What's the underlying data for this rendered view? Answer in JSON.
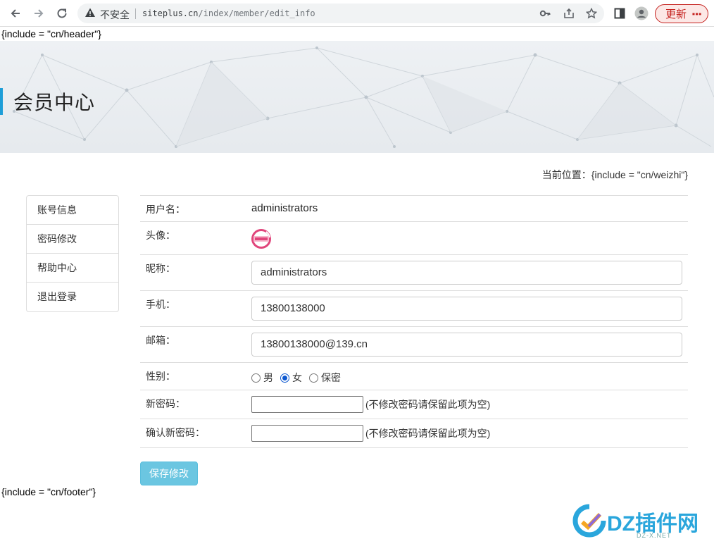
{
  "browser": {
    "insecure_label": "不安全",
    "url_domain": "siteplus.cn",
    "url_path": "/index/member/edit_info",
    "update_label": "更新",
    "colors": {
      "update": "#c5221f"
    }
  },
  "page": {
    "header_include": "{include = \"cn/header\"}",
    "footer_include": "{include = \"cn/footer\"}",
    "banner_title": "会员中心",
    "breadcrumb": "当前位置：{include = \"cn/weizhi\"}",
    "accent_color": "#1e9ed8"
  },
  "sidebar": {
    "items": [
      {
        "label": "账号信息"
      },
      {
        "label": "密码修改"
      },
      {
        "label": "帮助中心"
      },
      {
        "label": "退出登录"
      }
    ]
  },
  "form": {
    "username": {
      "label": "用户名：",
      "value": "administrators"
    },
    "avatar": {
      "label": "头像：",
      "icon": "avatar-icon"
    },
    "nickname": {
      "label": "昵称：",
      "value": "administrators"
    },
    "phone": {
      "label": "手机：",
      "value": "13800138000"
    },
    "email": {
      "label": "邮箱：",
      "value": "13800138000@139.cn"
    },
    "gender": {
      "label": "性别：",
      "options": [
        "男",
        "女",
        "保密"
      ],
      "selected": "女"
    },
    "new_password": {
      "label": "新密码：",
      "hint": "(不修改密码请保留此项为空)"
    },
    "confirm_password": {
      "label": "确认新密码：",
      "hint": "(不修改密码请保留此项为空)"
    },
    "save_label": "保存修改",
    "save_color": "#5bc0de"
  },
  "watermark": {
    "text": "DZ插件网",
    "sub": "DZ-X.NET"
  }
}
